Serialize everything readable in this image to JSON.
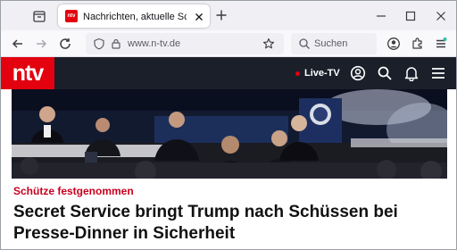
{
  "browser": {
    "tab": {
      "title": "Nachrichten, aktuelle Schlagzeilen",
      "favicon_text": "ntv"
    },
    "url": "www.n-tv.de",
    "search_placeholder": "Suchen"
  },
  "site": {
    "logo": "ntv",
    "live_label": "Live-TV",
    "brand_color": "#e3000f",
    "header_color": "#1a1f2a"
  },
  "article": {
    "kicker": "Schütze festgenommen",
    "headline": "Secret Service bringt Trump nach Schüssen bei Presse-Dinner in Sicherheit",
    "image_alt": "Trump auf der Bühne beim Presse-Dinner"
  }
}
